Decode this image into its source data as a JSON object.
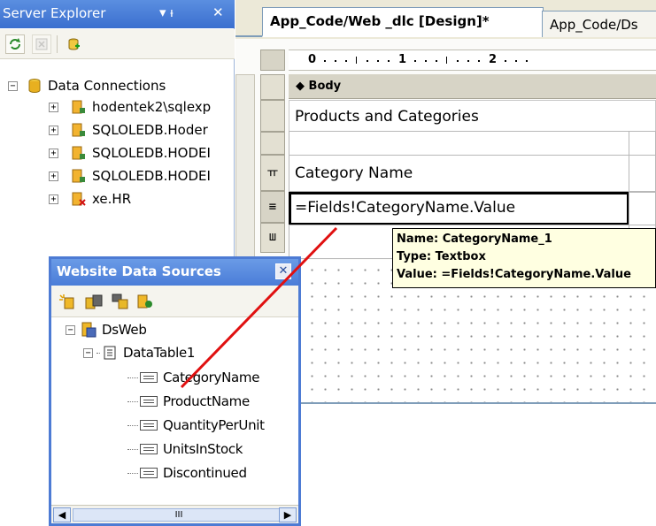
{
  "server_explorer": {
    "title": "Server Explorer",
    "pin_glyph": "▾ ᵼ",
    "close_glyph": "✕",
    "tree": {
      "root": "Data Connections",
      "connections": [
        {
          "label": "hodentek2\\sqlexp",
          "state": "ok"
        },
        {
          "label": "SQLOLEDB.Hoder",
          "state": "ok"
        },
        {
          "label": "SQLOLEDB.HODEI",
          "state": "ok"
        },
        {
          "label": "SQLOLEDB.HODEI",
          "state": "ok"
        },
        {
          "label": "xe.HR",
          "state": "error"
        }
      ]
    }
  },
  "designer": {
    "tabs": [
      "App_Code/Web _dlc [Design]*",
      "App_Code/Ds"
    ],
    "ruler": {
      "labels": [
        "0",
        "1",
        "2"
      ]
    },
    "section_label": "Body",
    "report_title": "Products and Categories",
    "header_cell": "Category Name",
    "detail_cell": "=Fields!CategoryName.Value",
    "tooltip": {
      "name": "Name: CategoryName_1",
      "type": "Type: Textbox",
      "value": "Value: =Fields!CategoryName.Value"
    }
  },
  "data_sources": {
    "title": "Website Data Sources",
    "close_glyph": "✕",
    "dataset": "DsWeb",
    "table": "DataTable1",
    "fields": [
      "CategoryName",
      "ProductName",
      "QuantityPerUnit",
      "UnitsInStock",
      "Discontinued"
    ],
    "scroll_left": "◀",
    "scroll_right": "▶",
    "scroll_grip": "III"
  },
  "colors": {
    "title_bar": "#3a6fcf",
    "tooltip_bg": "#ffffe1",
    "drag_line": "#e01010"
  }
}
